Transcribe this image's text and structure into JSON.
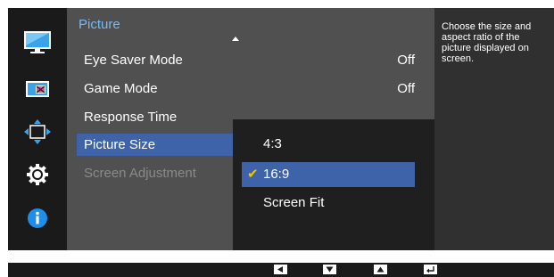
{
  "menu": {
    "title": "Picture",
    "items": [
      {
        "label": "Eye Saver Mode",
        "value": "Off"
      },
      {
        "label": "Game Mode",
        "value": "Off"
      },
      {
        "label": "Response Time",
        "value": ""
      },
      {
        "label": "Picture Size",
        "value": ""
      },
      {
        "label": "Screen Adjustment",
        "value": ""
      }
    ],
    "selected_item": "Picture Size"
  },
  "submenu": {
    "options": [
      {
        "label": "4:3"
      },
      {
        "label": "16:9"
      },
      {
        "label": "Screen Fit"
      }
    ],
    "selected_option": "16:9"
  },
  "help": {
    "text": "Choose the size and aspect ratio of the picture displayed on screen."
  },
  "icons": [
    "picture-icon",
    "color-icon",
    "size-position-icon",
    "settings-icon",
    "info-icon"
  ],
  "bottom_keys": [
    "left-arrow-key",
    "down-arrow-key",
    "up-arrow-key",
    "enter-key"
  ],
  "colors": {
    "accent_title": "#79b8f0",
    "selection": "#3f63a8",
    "checkmark": "#f4c400",
    "info_icon": "#1e8ee8"
  }
}
